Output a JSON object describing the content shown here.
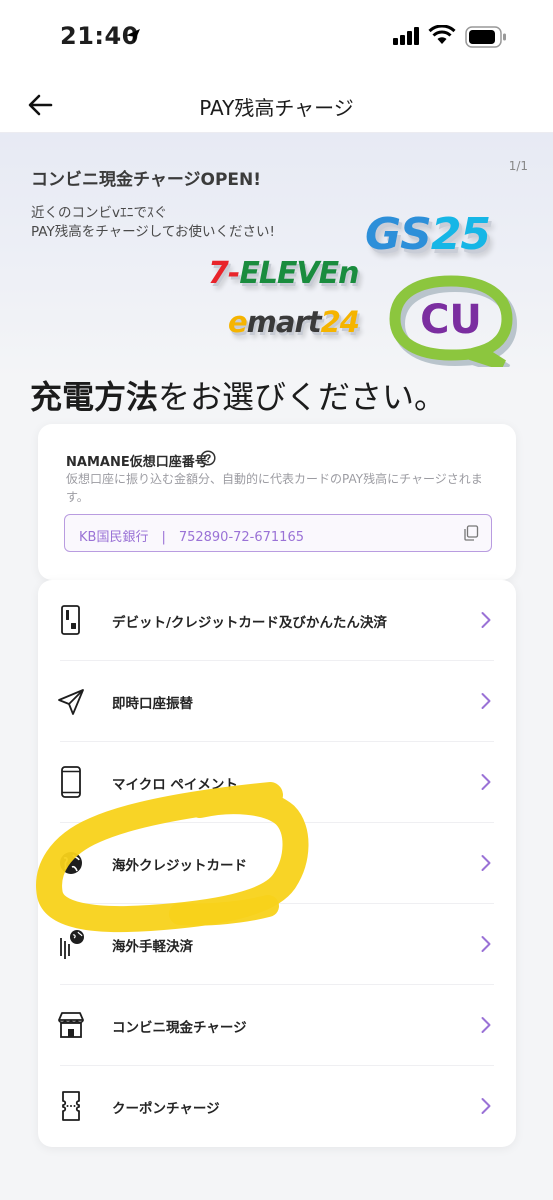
{
  "status_bar": {
    "time": "21:40"
  },
  "nav": {
    "title": "PAY残高チャージ"
  },
  "banner": {
    "title": "コンビニ現金チャージOPEN!",
    "subtitle": "近くのコンビvｴﾆでｽぐ\nPAY残高をチャージしてお使いください!",
    "pager": "1/1",
    "logos": {
      "gs25_a": "GS",
      "gs25_b": "25",
      "seven_a": "7-",
      "seven_b": "ELEVEn",
      "emart_a": "e",
      "emart_b": "mart",
      "emart_c": "24",
      "cu": "CU"
    }
  },
  "heading": {
    "bold": "充電方法",
    "rest": "をお選びください。"
  },
  "virtual_account": {
    "title": "NAMANE仮想口座番号",
    "description": "仮想口座に振り込む金額分、自動的に代表カードのPAY残高にチャージされます。",
    "account_text": "KB国民銀行　|　752890-72-671165"
  },
  "methods": [
    {
      "label": "デビット/クレジットカード及びかんたん決済",
      "icon": "card-icon"
    },
    {
      "label": "即時口座振替",
      "icon": "send-icon"
    },
    {
      "label": "マイクロ ペイメント",
      "icon": "phone-icon"
    },
    {
      "label": "海外クレジットカード",
      "icon": "globe-icon"
    },
    {
      "label": "海外手軽決済",
      "icon": "globe-card-icon"
    },
    {
      "label": "コンビニ現金チャージ",
      "icon": "store-icon"
    },
    {
      "label": "クーポンチャージ",
      "icon": "coupon-icon"
    }
  ],
  "colors": {
    "accent": "#9a72d6",
    "highlight": "#f8d21a"
  }
}
